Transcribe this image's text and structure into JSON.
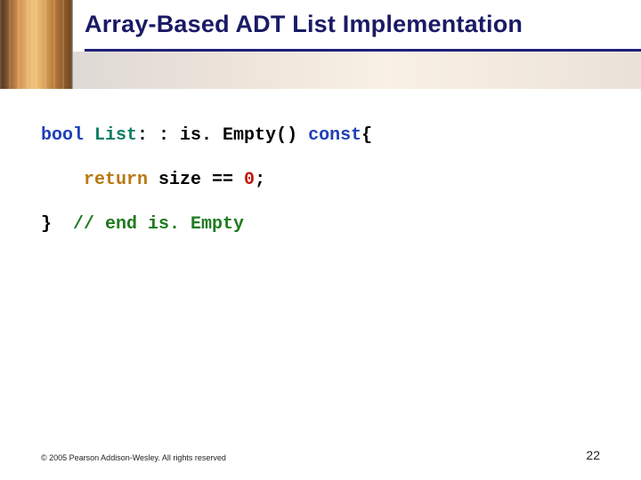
{
  "title": "Array-Based ADT List Implementation",
  "code": {
    "line1": {
      "kw_bool": "bool ",
      "type": "List",
      "colons": ": : ",
      "method": "is. Empty() ",
      "kw_const": "const",
      "brace": "{"
    },
    "line2": {
      "indent": "    ",
      "ret": "return ",
      "rest": "size == ",
      "zero": "0",
      "semi": ";"
    },
    "line3": {
      "brace": "}",
      "gap": "  ",
      "comment": "// end is. Empty"
    }
  },
  "footer": {
    "copyright": "© 2005 Pearson Addison-Wesley. All rights reserved",
    "page": "22"
  }
}
